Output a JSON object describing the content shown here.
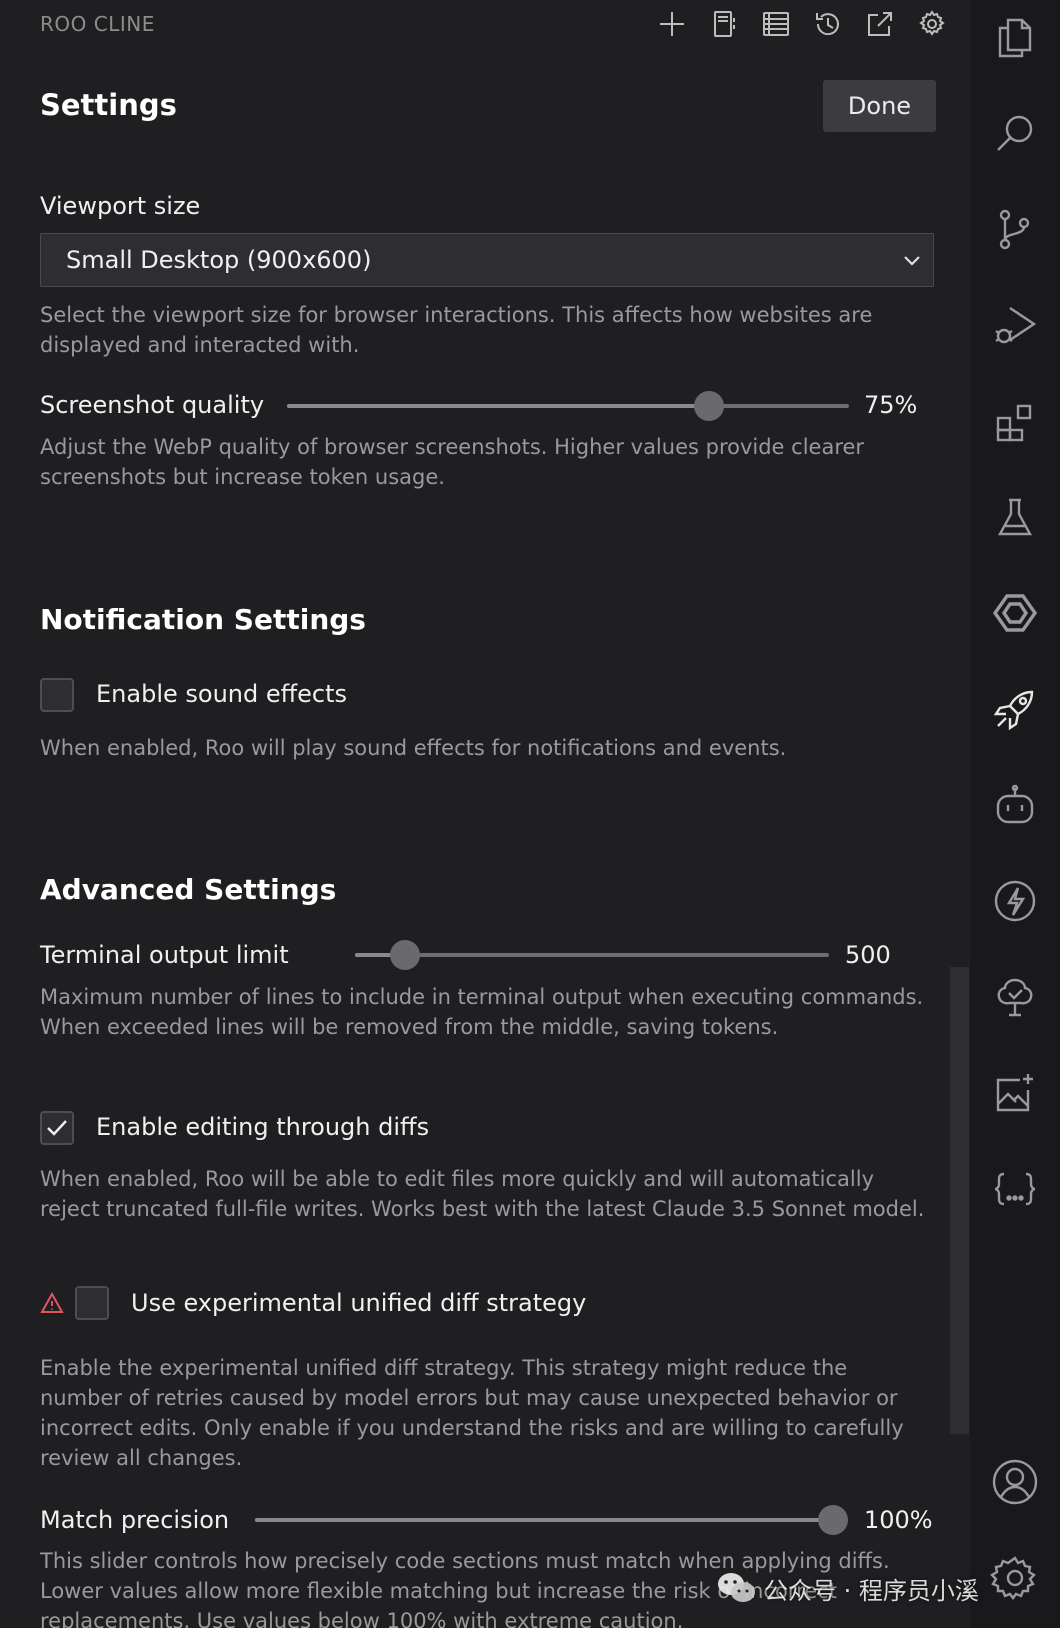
{
  "header": {
    "app_title": "ROO CLINE",
    "icons": [
      "plus-icon",
      "mcp-server-icon",
      "prompts-icon",
      "history-icon",
      "popout-icon",
      "settings-gear-icon"
    ]
  },
  "page": {
    "title": "Settings",
    "done_label": "Done"
  },
  "browser": {
    "viewport_label": "Viewport size",
    "viewport_value": "Small Desktop (900x600)",
    "viewport_desc": "Select the viewport size for browser interactions. This affects how websites are displayed and interacted with.",
    "quality_label": "Screenshot quality",
    "quality_value": 75,
    "quality_display": "75%",
    "quality_desc": "Adjust the WebP quality of browser screenshots. Higher values provide clearer screenshots but increase token usage."
  },
  "notifications": {
    "heading": "Notification Settings",
    "sound_label": "Enable sound effects",
    "sound_checked": false,
    "sound_desc": "When enabled, Roo will play sound effects for notifications and events."
  },
  "advanced": {
    "heading": "Advanced Settings",
    "terminal_label": "Terminal output limit",
    "terminal_fraction": 0.105,
    "terminal_display": "500",
    "terminal_desc": "Maximum number of lines to include in terminal output when executing commands. When exceeded lines will be removed from the middle, saving tokens.",
    "diffs_label": "Enable editing through diffs",
    "diffs_checked": true,
    "diffs_desc": "When enabled, Roo will be able to edit files more quickly and will automatically reject truncated full-file writes. Works best with the latest Claude 3.5 Sonnet model.",
    "unified_label": "Use experimental unified diff strategy",
    "unified_checked": false,
    "unified_desc": "Enable the experimental unified diff strategy. This strategy might reduce the number of retries caused by model errors but may cause unexpected behavior or incorrect edits. Only enable if you understand the risks and are willing to carefully review all changes.",
    "precision_label": "Match precision",
    "precision_value": 100,
    "precision_display": "100%",
    "precision_desc": "This slider controls how precisely code sections must match when applying diffs. Lower values allow more flexible matching but increase the risk of incorrect replacements. Use values below 100% with extreme caution."
  },
  "activity_bar": {
    "icons": [
      "explorer-icon",
      "search-icon",
      "source-control-icon",
      "run-debug-icon",
      "extensions-icon",
      "testing-icon",
      "remote-explorer-icon",
      "roo-rocket-icon",
      "copilot-bot-icon",
      "lightning-icon",
      "tree-check-icon",
      "image-sparkle-icon",
      "json-braces-icon",
      "account-icon",
      "manage-gear-icon"
    ]
  },
  "watermark": {
    "text": "公众号 · 程序员小溪"
  }
}
